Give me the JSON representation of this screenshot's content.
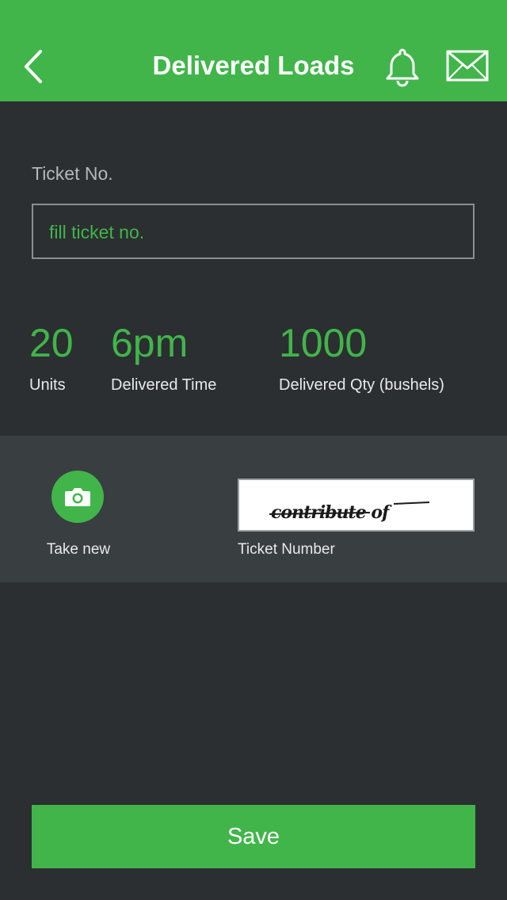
{
  "header": {
    "title": "Delivered Loads",
    "back_icon": "chevron-left-icon",
    "notification_icon": "bell-icon",
    "message_icon": "mail-icon"
  },
  "ticket": {
    "label": "Ticket No.",
    "placeholder": "fill ticket no."
  },
  "stats": [
    {
      "value": "20",
      "label": "Units"
    },
    {
      "value": "6pm",
      "label": "Delivered Time"
    },
    {
      "value": "1000",
      "label": "Delivered Qty (bushels)"
    }
  ],
  "photo": {
    "camera_icon": "camera-icon",
    "take_new_label": "Take new",
    "image_caption_text": "contribute of",
    "image_label": "Ticket Number"
  },
  "actions": {
    "save_label": "Save"
  },
  "colors": {
    "accent": "#41b54a",
    "background": "#2b2f31",
    "band": "#393e40"
  }
}
